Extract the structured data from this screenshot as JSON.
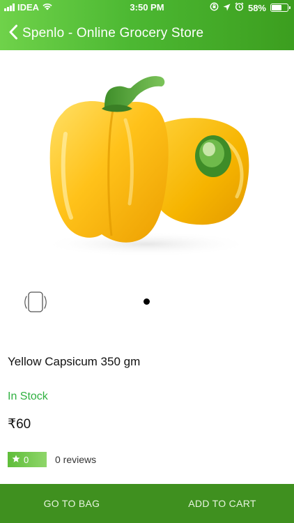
{
  "status_bar": {
    "carrier": "IDEA",
    "time": "3:50 PM",
    "battery": "58%",
    "icons": [
      "signal-icon",
      "wifi-icon",
      "orientation-lock-icon",
      "location-icon",
      "alarm-icon",
      "battery-icon"
    ]
  },
  "header": {
    "title": "Spenlo - Online Grocery Store",
    "back_icon": "chevron-left-icon"
  },
  "gallery": {
    "image_subject": "yellow capsicum",
    "rotate_icon": "device-rotate-icon",
    "page_count": 1,
    "current_page": 1
  },
  "product": {
    "name": "Yellow Capsicum 350 gm",
    "stock_status": "In Stock",
    "price": "₹60",
    "rating_value": "0",
    "reviews_text": "0 reviews"
  },
  "actions": {
    "go_to_bag": "GO TO BAG",
    "add_to_cart": "ADD TO CART"
  },
  "colors": {
    "header_start": "#6fd24a",
    "header_end": "#3c9e1f",
    "in_stock": "#2fb040",
    "bottom_bar": "#3f901f"
  }
}
